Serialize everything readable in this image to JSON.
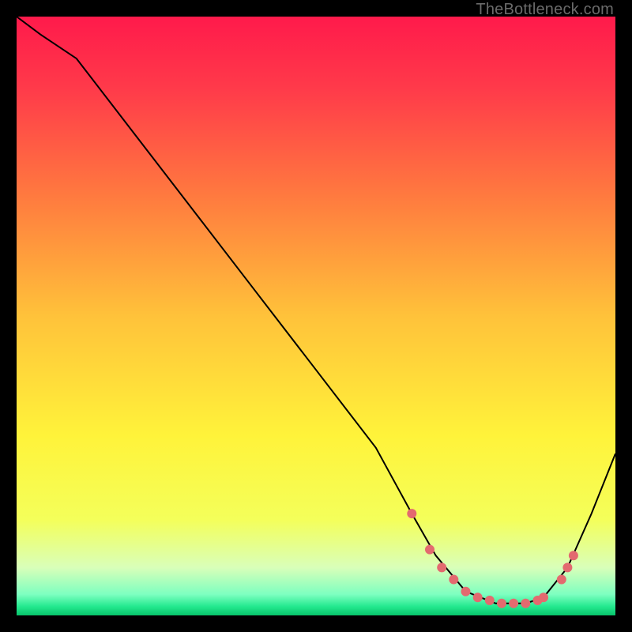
{
  "watermark": "TheBottleneck.com",
  "chart_data": {
    "type": "line",
    "title": "",
    "xlabel": "",
    "ylabel": "",
    "xlim": [
      0,
      100
    ],
    "ylim": [
      0,
      100
    ],
    "series": [
      {
        "name": "curve",
        "x": [
          0,
          4,
          10,
          20,
          30,
          40,
          50,
          60,
          66,
          70,
          75,
          80,
          85,
          88,
          92,
          96,
          100
        ],
        "y": [
          100,
          97,
          93,
          80,
          67,
          54,
          41,
          28,
          17,
          10,
          4,
          2,
          2,
          3,
          8,
          17,
          27
        ]
      }
    ],
    "markers": {
      "name": "flat-points",
      "color": "#e36a6f",
      "x": [
        66,
        69,
        71,
        73,
        75,
        77,
        79,
        81,
        83,
        85,
        87,
        88,
        91,
        92,
        93
      ],
      "y": [
        17,
        11,
        8,
        6,
        4,
        3,
        2.5,
        2,
        2,
        2,
        2.5,
        3,
        6,
        8,
        10
      ]
    },
    "background_gradient": {
      "stops": [
        {
          "offset": 0.0,
          "color": "#ff1a4b"
        },
        {
          "offset": 0.12,
          "color": "#ff3a4a"
        },
        {
          "offset": 0.3,
          "color": "#ff7a3f"
        },
        {
          "offset": 0.5,
          "color": "#ffc23a"
        },
        {
          "offset": 0.7,
          "color": "#fff33a"
        },
        {
          "offset": 0.84,
          "color": "#f4ff5a"
        },
        {
          "offset": 0.92,
          "color": "#d9ffb9"
        },
        {
          "offset": 0.965,
          "color": "#7dffc0"
        },
        {
          "offset": 0.985,
          "color": "#24e98f"
        },
        {
          "offset": 1.0,
          "color": "#07c36a"
        }
      ]
    }
  }
}
